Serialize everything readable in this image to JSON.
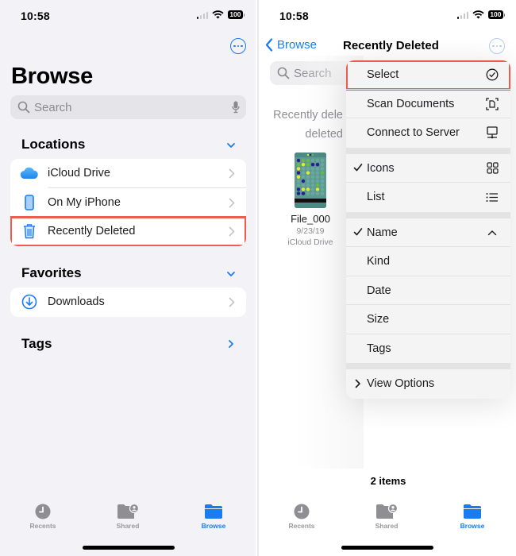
{
  "status_bar": {
    "time": "10:58",
    "battery": "100"
  },
  "left": {
    "title": "Browse",
    "search_placeholder": "Search",
    "sections": {
      "locations": {
        "header": "Locations",
        "items": [
          {
            "label": "iCloud Drive",
            "icon": "icloud-icon"
          },
          {
            "label": "On My iPhone",
            "icon": "iphone-icon"
          },
          {
            "label": "Recently Deleted",
            "icon": "trash-icon",
            "highlighted": true
          }
        ]
      },
      "favorites": {
        "header": "Favorites",
        "items": [
          {
            "label": "Downloads",
            "icon": "download-icon"
          }
        ]
      },
      "tags": {
        "header": "Tags"
      }
    }
  },
  "right": {
    "back_label": "Browse",
    "nav_title": "Recently Deleted",
    "search_placeholder": "Search",
    "empty_note_line1": "Recently dele",
    "empty_note_line2": "deleted",
    "file": {
      "name": "File_000",
      "date": "9/23/19",
      "location": "iCloud Drive"
    },
    "items_count": "2 items",
    "menu": {
      "actions": [
        {
          "label": "Select",
          "icon": "checkmark-circle-icon",
          "highlighted": true
        },
        {
          "label": "Scan Documents",
          "icon": "scan-document-icon"
        },
        {
          "label": "Connect to Server",
          "icon": "server-icon"
        }
      ],
      "view_modes": [
        {
          "label": "Icons",
          "icon": "grid-icon",
          "checked": true
        },
        {
          "label": "List",
          "icon": "list-icon",
          "checked": false
        }
      ],
      "sort": [
        {
          "label": "Name",
          "checked": true,
          "direction": "ascending"
        },
        {
          "label": "Kind"
        },
        {
          "label": "Date"
        },
        {
          "label": "Size"
        },
        {
          "label": "Tags"
        }
      ],
      "view_options": "View Options"
    }
  },
  "tab_bar": {
    "tabs": [
      {
        "label": "Recents",
        "active": false
      },
      {
        "label": "Shared",
        "active": false
      },
      {
        "label": "Browse",
        "active": true
      }
    ]
  },
  "colors": {
    "accent": "#1a7cf0",
    "highlight_box": "#f05a4f",
    "background": "#f2f2f7"
  }
}
